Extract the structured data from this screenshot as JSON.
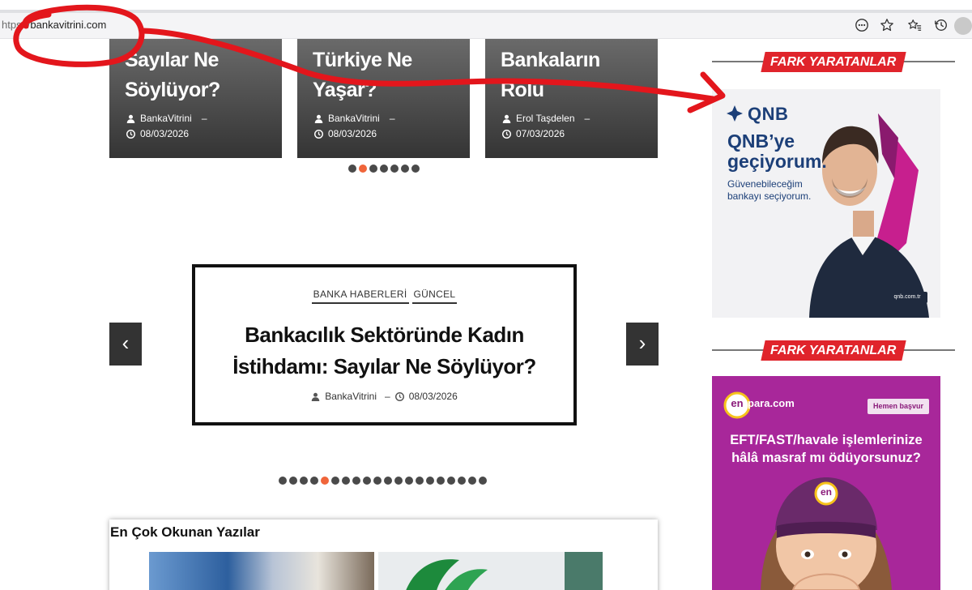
{
  "browser": {
    "url_scheme": "ht",
    "url_mid": "ps://",
    "url_host": "bankavitrini.com"
  },
  "top_cards": [
    {
      "title_l1": "Sayılar Ne",
      "title_l2": "Söylüyor?",
      "author": "BankaVitrini",
      "sep": "–",
      "date": "08/03/2026"
    },
    {
      "title_l1": "Türkiye Ne",
      "title_l2": "Yaşar?",
      "author": "BankaVitrini",
      "sep": "–",
      "date": "08/03/2026"
    },
    {
      "title_l1": "Bankaların",
      "title_l2": "Rolü",
      "author": "Erol Taşdelen",
      "sep": "–",
      "date": "07/03/2026"
    }
  ],
  "top_dots": {
    "count": 7,
    "active": 1
  },
  "slider": {
    "tags": [
      "BANKA HABERLERİ",
      "GÜNCEL"
    ],
    "title_l1": "Bankacılık Sektöründe Kadın",
    "title_l2": "İstihdamı: Sayılar Ne Söylüyor?",
    "author": "BankaVitrini",
    "sep": "–",
    "date": "08/03/2026",
    "prev": "‹",
    "next": "›"
  },
  "slider_dots": {
    "count": 20,
    "active": 4
  },
  "most_read": {
    "heading": "En Çok Okunan Yazılar"
  },
  "sidebar": {
    "section1": "FARK YARATANLAR",
    "section2": "FARK YARATANLAR",
    "ad1": {
      "brand": "QNB",
      "headline_l1": "QNB’ye",
      "headline_l2": "geçiyorum.",
      "sub_l1": "Güvenebileceğim",
      "sub_l2": "bankayı seçiyorum.",
      "site": "qnb.com.tr"
    },
    "ad2": {
      "brand_en": "en",
      "brand_para": "para.com",
      "cta": "Hemen başvur",
      "headline_l1": "EFT/FAST/havale işlemlerinize",
      "headline_l2": "hâlâ masraf mı ödüyorsunuz?",
      "hat_logo": "en"
    }
  },
  "colors": {
    "accent": "#f0653a",
    "badge": "#e0242b",
    "annotation": "#e3161c"
  }
}
